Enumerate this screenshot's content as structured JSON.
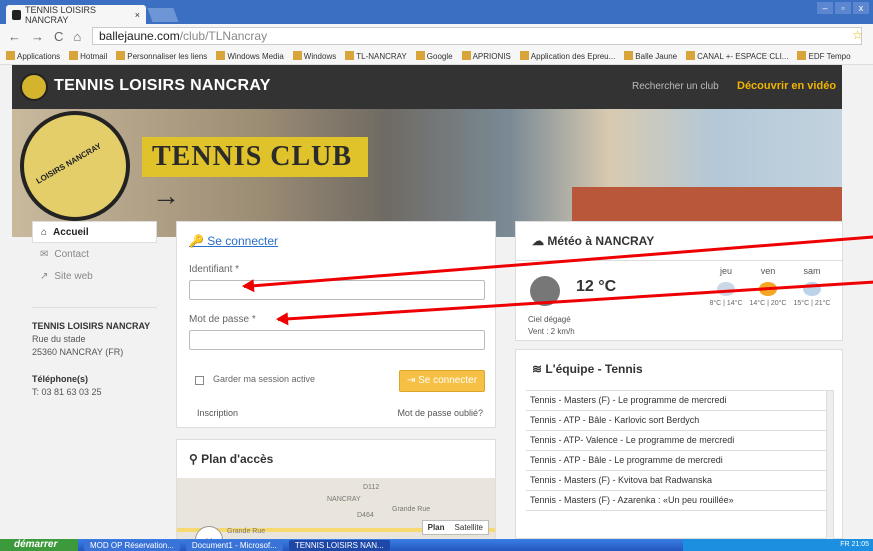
{
  "browser": {
    "tab_title": "TENNIS LOISIRS NANCRAY",
    "tab_close": "×",
    "url_host": "ballejaune.com",
    "url_path": "/club/TLNancray",
    "bookmarks": [
      "Applications",
      "Hotmail",
      "Personnaliser les liens",
      "Windows Media",
      "Windows",
      "TL-NANCRAY",
      "Google",
      "APRIONIS",
      "Application des Epreu...",
      "Balle Jaune",
      "CANAL +- ESPACE CLI...",
      "EDF Tempo"
    ]
  },
  "site": {
    "title": "TENNIS LOISIRS NANCRAY",
    "search_club": "Rechercher un club",
    "video": "Découvrir en vidéo",
    "banner_text": "TENNIS CLUB →",
    "seal_text": "LOISIRS NANCRAY"
  },
  "sidebar": {
    "items": [
      {
        "label": "Accueil",
        "icon": "home-icon"
      },
      {
        "label": "Contact",
        "icon": "mail-icon"
      },
      {
        "label": "Site web",
        "icon": "external-link-icon"
      }
    ],
    "club_name": "TENNIS LOISIRS NANCRAY",
    "address1": "Rue du stade",
    "address2": "25360 NANCRAY (FR)",
    "phone_label": "Téléphone(s)",
    "phone": "T: 03 81 63 03 25"
  },
  "login": {
    "title": "Se connecter",
    "id_label": "Identifiant *",
    "id_value": "",
    "pw_label": "Mot de passe *",
    "pw_value": "",
    "remember": "Garder ma session active",
    "button": "Se connecter",
    "signup": "Inscription",
    "forgot": "Mot de passe oublié?"
  },
  "map": {
    "title": "Plan d'accès",
    "plan": "Plan",
    "satellite": "Satellite",
    "labels": [
      "D112",
      "NANCRAY",
      "Grande Rue",
      "D464",
      "Grande Rue"
    ]
  },
  "meteo": {
    "title": "Météo à NANCRAY",
    "temp": "12 °C",
    "condition": "Ciel dégagé",
    "wind": "Vent : 2 km/h",
    "forecast": [
      {
        "day": "jeu",
        "range": "8°C | 14°C"
      },
      {
        "day": "ven",
        "range": "14°C | 20°C"
      },
      {
        "day": "sam",
        "range": "15°C | 21°C"
      }
    ]
  },
  "team": {
    "title": "L'équipe - Tennis",
    "items": [
      "Tennis - Masters (F) - Le programme de mercredi",
      "Tennis - ATP - Bâle - Karlovic sort Berdych",
      "Tennis - ATP- Valence - Le programme de mercredi",
      "Tennis - ATP - Bâle - Le programme de mercredi",
      "Tennis - Masters (F) - Kvitova bat Radwanska",
      "Tennis - Masters (F) - Azarenka : «Un peu rouillée»"
    ]
  },
  "taskbar": {
    "start": "démarrer",
    "items": [
      "MOD OP Réservation...",
      "Document1 - Microsof...",
      "TENNIS LOISIRS NAN..."
    ],
    "clock": "FR 21:05"
  },
  "colors": {
    "accent": "#f5c043",
    "arrow": "#e00000",
    "link": "#2a6fc9"
  }
}
